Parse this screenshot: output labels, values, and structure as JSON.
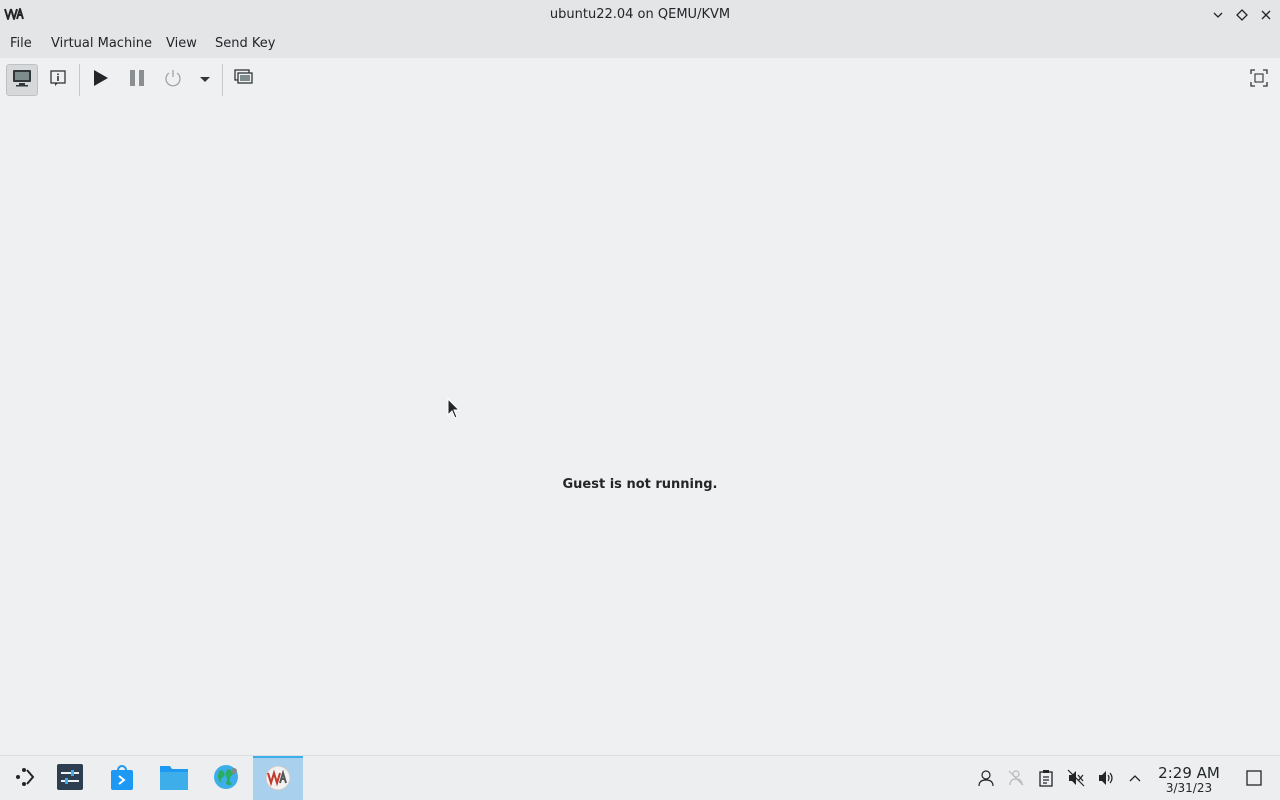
{
  "window": {
    "title": "ubuntu22.04 on QEMU/KVM",
    "logo_icon": "virt-manager-logo-icon",
    "controls": [
      "minimize-icon",
      "maximize-icon",
      "close-icon"
    ]
  },
  "menubar": {
    "items": [
      {
        "label": "File"
      },
      {
        "label": "Virtual Machine"
      },
      {
        "label": "View"
      },
      {
        "label": "Send Key"
      }
    ]
  },
  "toolbar": {
    "buttons": [
      {
        "icon": "console-monitor-icon",
        "active": true
      },
      {
        "icon": "details-info-icon",
        "active": false
      },
      {
        "icon": "run-play-icon",
        "active": false
      },
      {
        "icon": "pause-icon",
        "active": false
      },
      {
        "icon": "shutdown-power-icon",
        "active": false
      },
      {
        "icon": "dropdown-arrow-icon",
        "active": false
      },
      {
        "icon": "snapshots-icon",
        "active": false
      },
      {
        "icon": "fullscreen-icon",
        "active": false
      }
    ]
  },
  "content": {
    "status_message": "Guest is not running."
  },
  "taskbar": {
    "items": [
      {
        "icon": "application-launcher-icon"
      },
      {
        "icon": "system-settings-icon"
      },
      {
        "icon": "discover-store-icon"
      },
      {
        "icon": "file-manager-icon"
      },
      {
        "icon": "web-browser-icon"
      },
      {
        "icon": "virt-manager-icon",
        "active": true
      }
    ],
    "tray": [
      "user-switch-icon",
      "kde-connect-icon",
      "clipboard-icon",
      "audio-muted-icon",
      "volume-icon",
      "expand-tray-icon"
    ],
    "clock": {
      "time": "2:29 AM",
      "date": "3/31/23"
    },
    "show_desktop_icon": "show-desktop-icon"
  },
  "colors": {
    "accent": "#3daee9",
    "active_task_bg": "#a9d1ee",
    "window_bg": "#eff0f1"
  }
}
